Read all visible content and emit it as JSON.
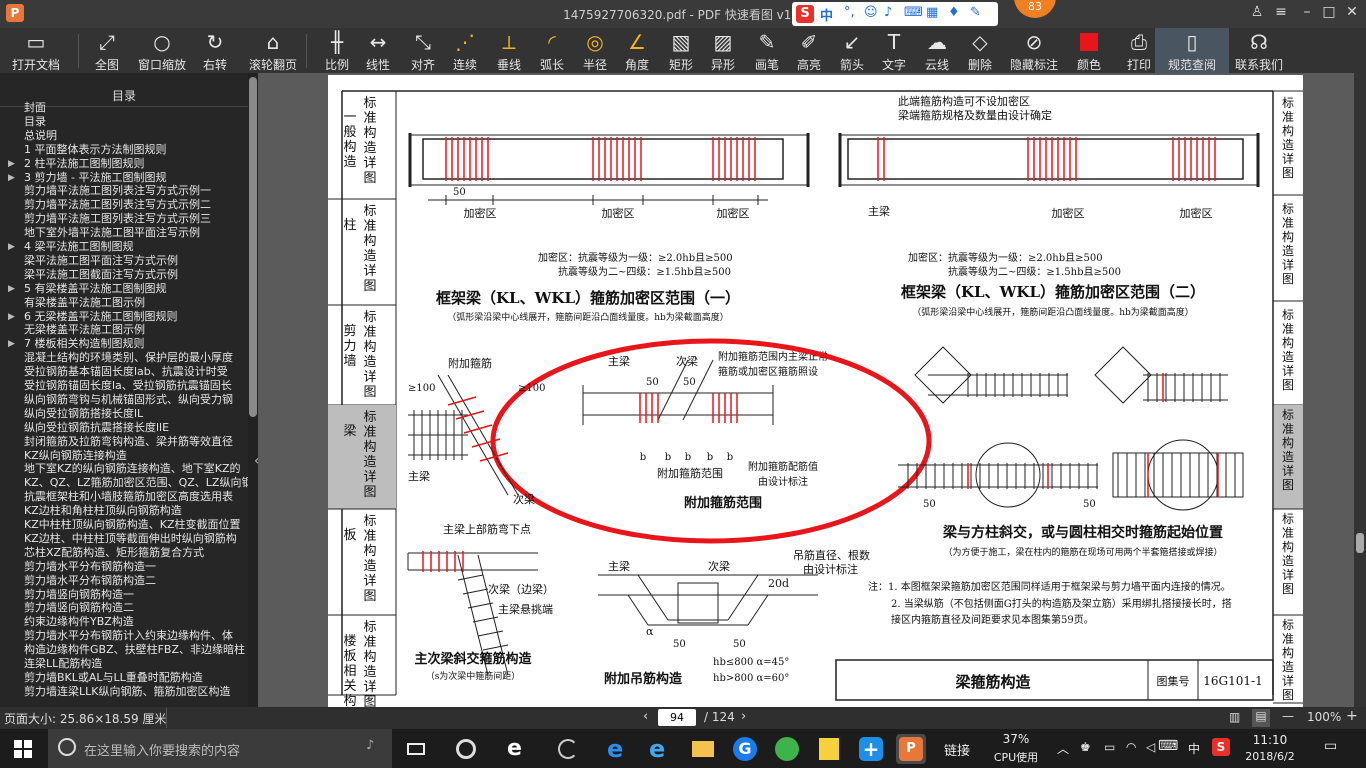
{
  "window": {
    "title": "1475927706320.pdf - PDF 快速看图 v1.9",
    "app_logo": "P",
    "badge": "83",
    "ime_label": "中"
  },
  "toolbar": [
    {
      "name": "open",
      "label": "打开文档",
      "icon": "folder-icon"
    },
    {
      "name": "fit",
      "label": "全图",
      "icon": "fullscreen-icon"
    },
    {
      "name": "zoom-window",
      "label": "窗口缩放",
      "icon": "magnifier-icon"
    },
    {
      "name": "rotate-right",
      "label": "右转",
      "icon": "rotate-icon"
    },
    {
      "name": "scroll-page",
      "label": "滚轮翻页",
      "icon": "mouse-icon"
    },
    {
      "name": "scale",
      "label": "比例",
      "icon": "ruler-icon"
    },
    {
      "name": "linear",
      "label": "线性",
      "icon": "linear-icon"
    },
    {
      "name": "aligned",
      "label": "对齐",
      "icon": "aligned-icon"
    },
    {
      "name": "continuous",
      "label": "连续",
      "icon": "continuous-icon"
    },
    {
      "name": "perpendicular",
      "label": "垂线",
      "icon": "perpendicular-icon"
    },
    {
      "name": "arc-length",
      "label": "弧长",
      "icon": "arc-icon"
    },
    {
      "name": "radius",
      "label": "半径",
      "icon": "radius-icon"
    },
    {
      "name": "angle",
      "label": "角度",
      "icon": "angle-icon"
    },
    {
      "name": "rectangle",
      "label": "矩形",
      "icon": "rect-hatch-icon"
    },
    {
      "name": "irregular",
      "label": "异形",
      "icon": "irregular-icon"
    },
    {
      "name": "pen",
      "label": "画笔",
      "icon": "pen-icon"
    },
    {
      "name": "highlighter",
      "label": "高亮",
      "icon": "highlighter-icon"
    },
    {
      "name": "arrow",
      "label": "箭头",
      "icon": "arrow-icon"
    },
    {
      "name": "text",
      "label": "文字",
      "icon": "text-icon"
    },
    {
      "name": "cloud",
      "label": "云线",
      "icon": "cloud-icon"
    },
    {
      "name": "delete",
      "label": "删除",
      "icon": "eraser-icon"
    },
    {
      "name": "hide-markup",
      "label": "隐藏标注",
      "icon": "eye-off-icon"
    },
    {
      "name": "color",
      "label": "颜色",
      "icon": "color-swatch-icon",
      "color": "#e8161b"
    },
    {
      "name": "print",
      "label": "打印",
      "icon": "printer-icon"
    },
    {
      "name": "standard-lookup",
      "label": "规范查阅",
      "icon": "book-icon"
    },
    {
      "name": "contact",
      "label": "联系我们",
      "icon": "headset-icon"
    }
  ],
  "sidebar": {
    "title": "目录",
    "items": [
      {
        "label": "封面",
        "arrow": false
      },
      {
        "label": "目录",
        "arrow": false
      },
      {
        "label": "总说明",
        "arrow": false
      },
      {
        "label": "1 平面整体表示方法制图规则",
        "arrow": false
      },
      {
        "label": "2 柱平法施工图制图规则",
        "arrow": true
      },
      {
        "label": "3 剪力墙 - 平法施工图制图规",
        "arrow": true
      },
      {
        "label": "剪力墙平法施工图列表注写方式示例一",
        "arrow": false
      },
      {
        "label": "剪力墙平法施工图列表注写方式示例二",
        "arrow": false
      },
      {
        "label": "剪力墙平法施工图列表注写方式示例三",
        "arrow": false
      },
      {
        "label": "地下室外墙平法施工图平面注写示例",
        "arrow": false
      },
      {
        "label": "4 梁平法施工图制图规",
        "arrow": true
      },
      {
        "label": "梁平法施工图平面注写方式示例",
        "arrow": false
      },
      {
        "label": "梁平法施工图截面注写方式示例",
        "arrow": false
      },
      {
        "label": "5 有梁楼盖平法施工图制图规",
        "arrow": true
      },
      {
        "label": "有梁楼盖平法施工图示例",
        "arrow": false
      },
      {
        "label": "6 无梁楼盖平法施工图制图规则",
        "arrow": true
      },
      {
        "label": "无梁楼盖平法施工图示例",
        "arrow": false
      },
      {
        "label": "7 楼板相关构造制图规则",
        "arrow": true
      },
      {
        "label": "混凝土结构的环境类别、保护层的最小厚度",
        "arrow": false
      },
      {
        "label": "受拉钢筋基本锚固长度lab、抗震设计时受",
        "arrow": false
      },
      {
        "label": "受拉钢筋锚固长度la、受拉钢筋抗震锚固长",
        "arrow": false
      },
      {
        "label": "纵向钢筋弯钩与机械锚固形式、纵向受力钢",
        "arrow": false
      },
      {
        "label": "纵向受拉钢筋搭接长度lL",
        "arrow": false
      },
      {
        "label": "纵向受拉钢筋抗震搭接长度llE",
        "arrow": false
      },
      {
        "label": "封闭箍筋及拉筋弯钩构造、梁并筋等效直径",
        "arrow": false
      },
      {
        "label": "KZ纵向钢筋连接构造",
        "arrow": false
      },
      {
        "label": "地下室KZ的纵向钢筋连接构造、地下室KZ的",
        "arrow": false
      },
      {
        "label": "KZ、QZ、LZ箍筋加密区范围、QZ、LZ纵向钢",
        "arrow": false
      },
      {
        "label": "抗震框架柱和小墙肢箍筋加密区高度选用表",
        "arrow": false
      },
      {
        "label": "KZ边柱和角柱柱顶纵向钢筋构造",
        "arrow": false
      },
      {
        "label": "KZ中柱柱顶纵向钢筋构造、KZ柱变截面位置",
        "arrow": false
      },
      {
        "label": "KZ边柱、中柱柱顶等截面伸出时纵向钢筋构",
        "arrow": false
      },
      {
        "label": "芯柱XZ配筋构造、矩形箍筋复合方式",
        "arrow": false
      },
      {
        "label": "剪力墙水平分布钢筋构造一",
        "arrow": false
      },
      {
        "label": "剪力墙水平分布钢筋构造二",
        "arrow": false
      },
      {
        "label": "剪力墙竖向钢筋构造一",
        "arrow": false
      },
      {
        "label": "剪力墙竖向钢筋构造二",
        "arrow": false
      },
      {
        "label": "约束边缘构件YBZ构造",
        "arrow": false
      },
      {
        "label": "剪力墙水平分布钢筋计入约束边缘构件、体",
        "arrow": false
      },
      {
        "label": "构造边缘构件GBZ、扶壁柱FBZ、非边缘暗柱",
        "arrow": false
      },
      {
        "label": "连梁LL配筋构造",
        "arrow": false
      },
      {
        "label": "剪力墙BKL或AL与LL重叠时配筋构造",
        "arrow": false
      },
      {
        "label": "剪力墙连梁LLK纵向钢筋、箍筋加密区构造",
        "arrow": false
      }
    ]
  },
  "drawing": {
    "left_tabs": [
      "标准构造详图",
      "标准构造详图",
      "标准构造详图",
      "标准构造详图",
      "标准构造详图",
      "标准构造详图"
    ],
    "left_groups": [
      "一般构造",
      "柱",
      "剪力墙",
      "梁",
      "板",
      "楼板相关构造"
    ],
    "right_tabs": [
      "标准构造详图",
      "标准构造详图",
      "标准构造详图",
      "标准构造详图",
      "标准构造详图",
      "标准构造详图"
    ],
    "title1": "框架梁（KL、WKL）箍筋加密区范围（一）",
    "sub1": "（弧形梁沿梁中心线展开，箍筋间距沿凸面线量度。hb为梁截面高度）",
    "title2": "框架梁（KL、WKL）箍筋加密区范围（二）",
    "sub2": "（弧形梁沿梁中心线展开，箍筋间距沿凸面线量度。hb为梁截面高度）",
    "note_top": "此端箍筋构造可不设加密区",
    "note_top2": "梁端箍筋规格及数量由设计确定",
    "zone": "加密区",
    "main_beam": "主梁",
    "sec_beam": "次梁",
    "req1a": "加密区：抗震等级为一级：≥2.0hb且≥500",
    "req1b": "抗震等级为二~四级：≥1.5hb且≥500",
    "stirrup_add": "附加箍筋",
    "stirrup_range": "附加箍筋范围",
    "stirrup_note1": "附加箍筋范围内主梁正常",
    "stirrup_note2": "箍筋或加密区箍筋照设",
    "stirrup_cfg1": "附加箍筋配筋值",
    "stirrup_cfg2": "由设计标注",
    "dim50": "50",
    "dim100": "≥100",
    "b": "b",
    "title_col": "梁与方柱斜交，或与圆柱相交时箍筋起始位置",
    "sub_col": "（为方便于施工，梁在柱内的箍筋在现场可用两个半套箍搭接或焊接）",
    "note1": "注：1. 本图框架梁箍筋加密区范围同样适用于框架梁与剪力墙平面内连接的情况。",
    "note2": "2. 当梁纵筋（不包括侧面G打头的构造筋及架立筋）采用绑扎搭接接长时，搭",
    "note3": "接区内箍筋直径及间距要求见本图集第59页。",
    "skew_top": "主梁上部筋弯下点",
    "cantilever": "次梁（边梁）",
    "cantilever2": "主梁悬挑端",
    "title_skew": "主次梁斜交箍筋构造",
    "sub_skew": "（s为次梁中箍筋间距）",
    "hanger_note1": "吊筋直径、根数",
    "hanger_note2": "由设计标注",
    "dim20d": "20d",
    "alpha": "α",
    "hb_rule1": "hb≤800  α=45°",
    "hb_rule2": "hb>800  α=60°",
    "title_hanger": "附加吊筋构造",
    "titleblock": "梁箍筋构造",
    "atlas_label": "图集号",
    "atlas": "16G101-1"
  },
  "statusbar": {
    "page_size": "页面大小: 25.86×18.59 厘米",
    "page": "94",
    "total": "/ 124",
    "zoom": "100%"
  },
  "taskbar": {
    "search_placeholder": "在这里输入你要搜索的内容",
    "link": "链接",
    "cpu_pct": "37%",
    "cpu_label": "CPU使用",
    "time": "11:10",
    "date": "2018/6/2",
    "ime": "中"
  }
}
